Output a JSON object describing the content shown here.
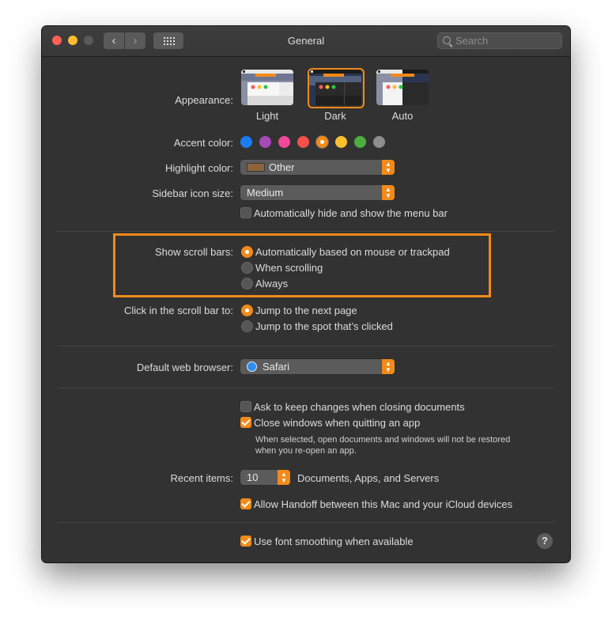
{
  "window": {
    "title": "General",
    "search_placeholder": "Search"
  },
  "appearance": {
    "label": "Appearance:",
    "options": [
      "Light",
      "Dark",
      "Auto"
    ],
    "selected": "Dark"
  },
  "accent": {
    "label": "Accent color:",
    "colors": [
      "#1a7cf3",
      "#a54bb5",
      "#f0489a",
      "#f6504f",
      "#f28a1a",
      "#fbc02d",
      "#4cae3f",
      "#8e8e8e"
    ],
    "selected_index": 4
  },
  "highlight": {
    "label": "Highlight color:",
    "value": "Other",
    "swatch_color": "#8e643c"
  },
  "sidebar_icon": {
    "label": "Sidebar icon size:",
    "value": "Medium"
  },
  "menu_bar": {
    "label": "Automatically hide and show the menu bar",
    "checked": false
  },
  "scroll_bars": {
    "label": "Show scroll bars:",
    "options": [
      "Automatically based on mouse or trackpad",
      "When scrolling",
      "Always"
    ],
    "selected_index": 0
  },
  "scroll_click": {
    "label": "Click in the scroll bar to:",
    "options": [
      "Jump to the next page",
      "Jump to the spot that’s clicked"
    ],
    "selected_index": 0
  },
  "browser": {
    "label": "Default web browser:",
    "value": "Safari"
  },
  "documents": {
    "ask_keep": "Ask to keep changes when closing documents",
    "ask_keep_checked": false,
    "close_windows": "Close windows when quitting an app",
    "close_windows_checked": true,
    "note_line1": "When selected, open documents and windows will not be restored",
    "note_line2": "when you re-open an app."
  },
  "recent": {
    "label": "Recent items:",
    "value": "10",
    "suffix": "Documents, Apps, and Servers"
  },
  "handoff": {
    "label": "Allow Handoff between this Mac and your iCloud devices",
    "checked": true
  },
  "font_smoothing": {
    "label": "Use font smoothing when available",
    "checked": true
  },
  "help_symbol": "?",
  "colors": {
    "accent_orange": "#f28a1a",
    "window_bg": "#323232"
  }
}
